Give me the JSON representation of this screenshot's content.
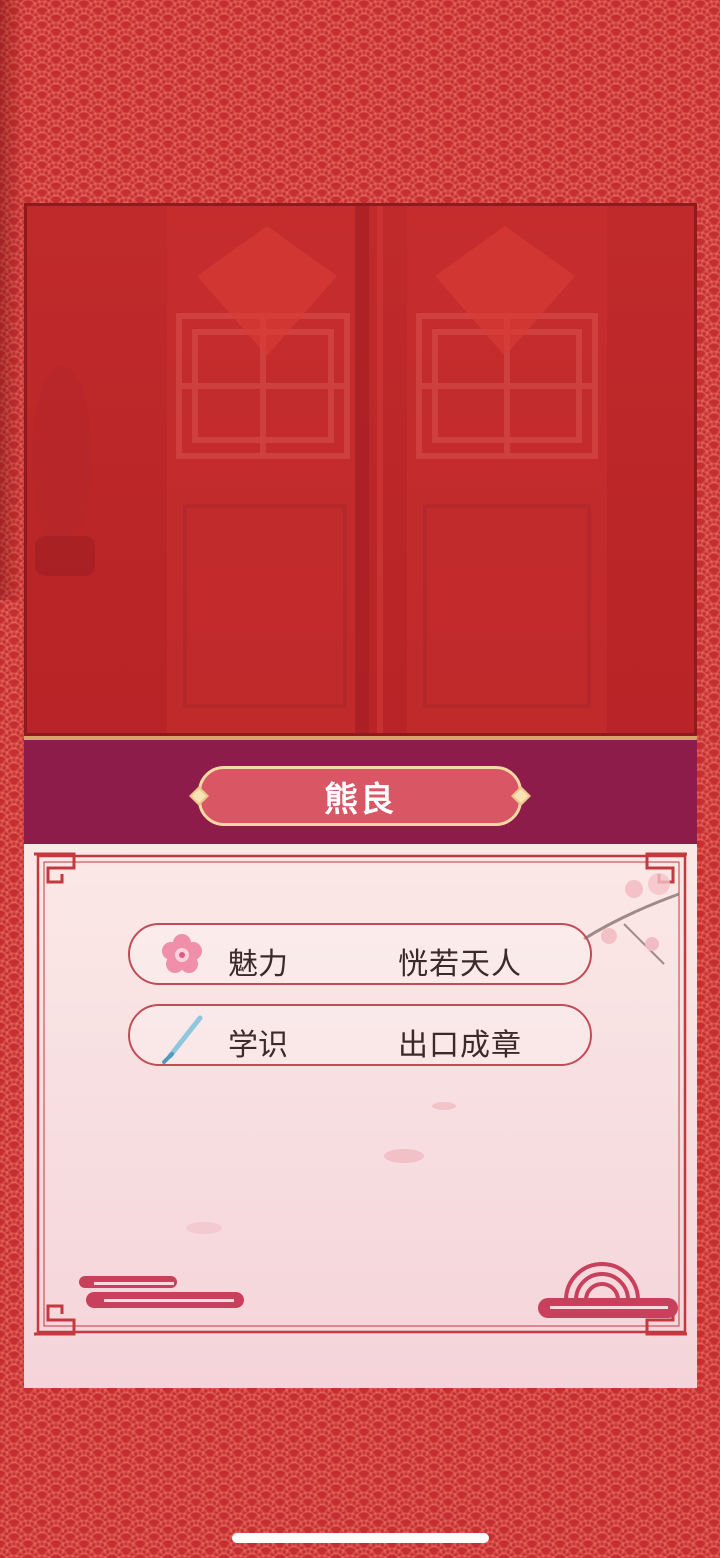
{
  "character": {
    "name": "熊良"
  },
  "stats": [
    {
      "label": "魅力",
      "value": "恍若天人",
      "icon": "plum-blossom-icon"
    },
    {
      "label": "学识",
      "value": "出口成章",
      "icon": "brush-pen-icon"
    }
  ],
  "colors": {
    "background": "#c62f31",
    "name_band": "#8d1c4a",
    "name_plate": "#d95665",
    "card": "#fbe9e6",
    "accent": "#c24b55"
  }
}
